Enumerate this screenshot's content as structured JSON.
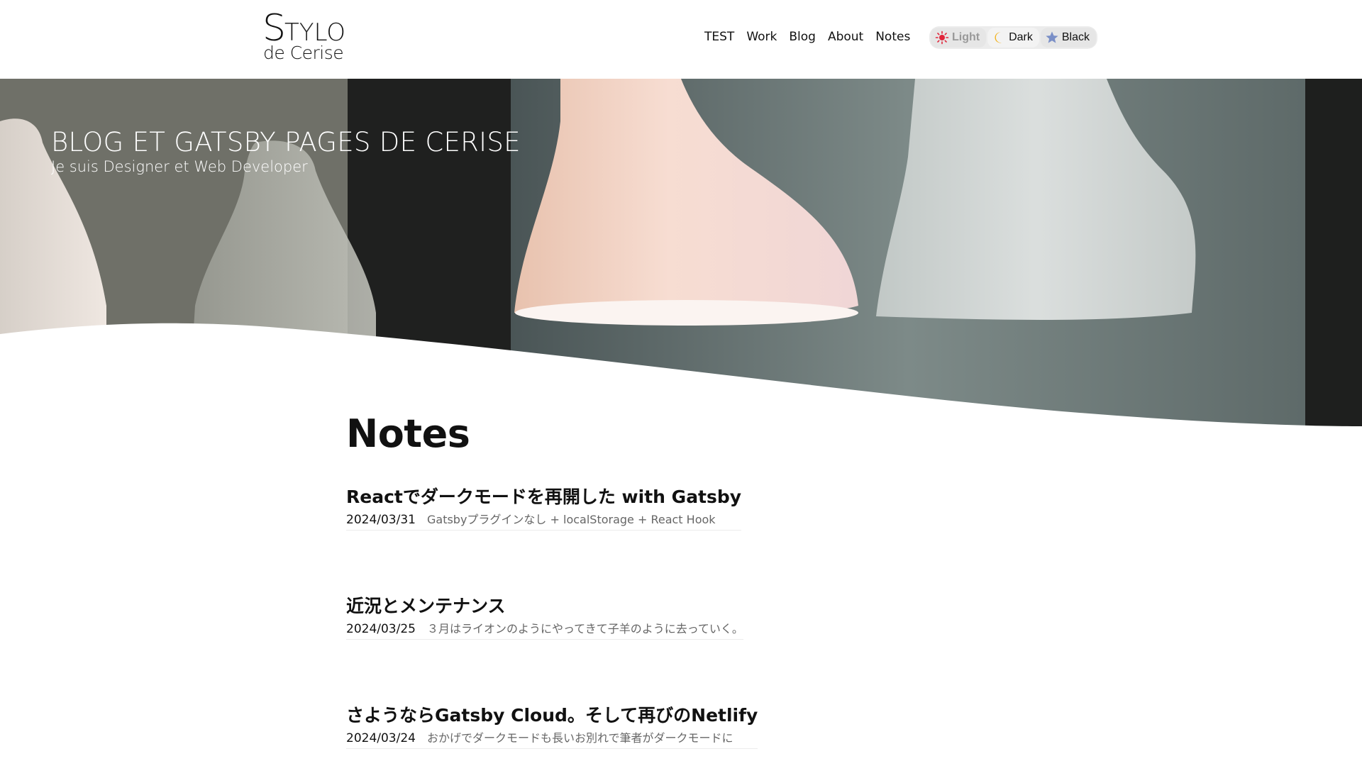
{
  "logo": {
    "s": "S",
    "tylo_t": "T",
    "tylo_y": "Y",
    "tylo_lo": "LO",
    "sub": "de Cerise"
  },
  "nav": {
    "items": [
      {
        "label": "TEST"
      },
      {
        "label": "Work"
      },
      {
        "label": "Blog"
      },
      {
        "label": "About"
      },
      {
        "label": "Notes"
      }
    ]
  },
  "theme": {
    "light": {
      "label": "Light",
      "icon": "sun-icon",
      "color": "#e0263b"
    },
    "dark": {
      "label": "Dark",
      "icon": "moon-icon",
      "color": "#f2b21b"
    },
    "black": {
      "label": "Black",
      "icon": "star-icon",
      "color": "#7a8fc7"
    }
  },
  "hero": {
    "title": "BLOG ET GATSBY PAGES DE CERISE",
    "subtitle": "Je suis Designer et Web Developer"
  },
  "main": {
    "title": "Notes",
    "notes": [
      {
        "title": "Reactでダークモードを再開した with Gatsby",
        "date": "2024/03/31",
        "excerpt": "Gatsbyプラグインなし + localStorage + React Hook"
      },
      {
        "title": "近況とメンテナンス",
        "date": "2024/03/25",
        "excerpt": "３月はライオンのようにやってきて子羊のように去っていく。"
      },
      {
        "title": "さようならGatsby Cloud。そして再びのNetlify",
        "date": "2024/03/24",
        "excerpt": "おかげでダークモードも長いお別れで筆者がダークモードに"
      }
    ]
  }
}
